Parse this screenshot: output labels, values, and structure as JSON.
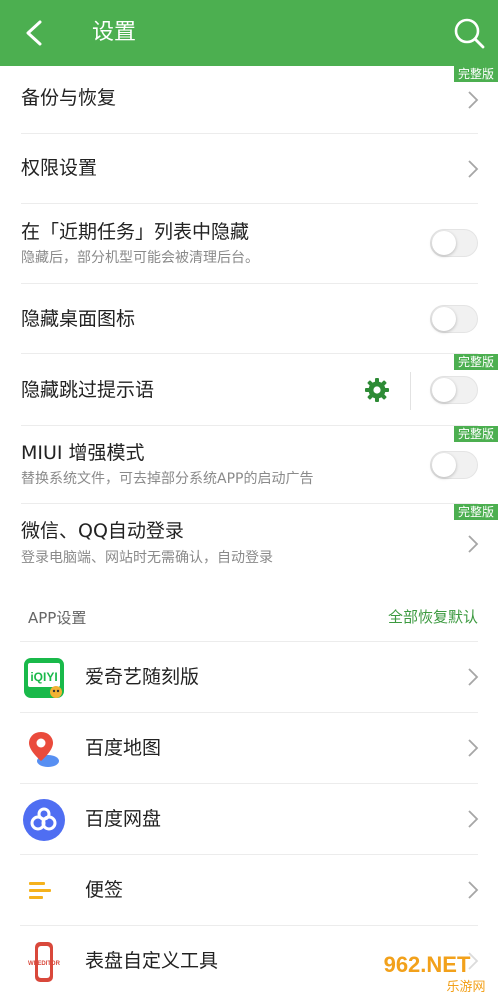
{
  "header": {
    "title": "设置"
  },
  "settings": [
    {
      "label": "备份与恢复",
      "badge": "完整版"
    },
    {
      "label": "权限设置"
    },
    {
      "label": "在「近期任务」列表中隐藏",
      "sub": "隐藏后，部分机型可能会被清理后台。"
    },
    {
      "label": "隐藏桌面图标"
    },
    {
      "label": "隐藏跳过提示语",
      "badge": "完整版"
    },
    {
      "label": "MIUI 增强模式",
      "sub": "替换系统文件，可去掉部分系统APP的启动广告",
      "badge": "完整版"
    },
    {
      "label": "微信、QQ自动登录",
      "sub": "登录电脑端、网站时无需确认，自动登录",
      "badge": "完整版"
    }
  ],
  "app_section": {
    "title": "APP设置",
    "reset_all": "全部恢复默认",
    "apps": [
      {
        "name": "爱奇艺随刻版",
        "icon": "iqiyi-icon",
        "icon_text": "iQIYI"
      },
      {
        "name": "百度地图",
        "icon": "baidu-map-icon"
      },
      {
        "name": "百度网盘",
        "icon": "baidu-netdisk-icon"
      },
      {
        "name": "便签",
        "icon": "notes-icon"
      },
      {
        "name": "表盘自定义工具",
        "icon": "watchface-tool-icon",
        "icon_text": "WFEDITOR"
      }
    ]
  },
  "watermark": {
    "line1": "962.NET",
    "line2": "乐游网"
  },
  "colors": {
    "accent": "#4caf50",
    "link": "#3c9a40",
    "gear": "#2e8b36"
  }
}
